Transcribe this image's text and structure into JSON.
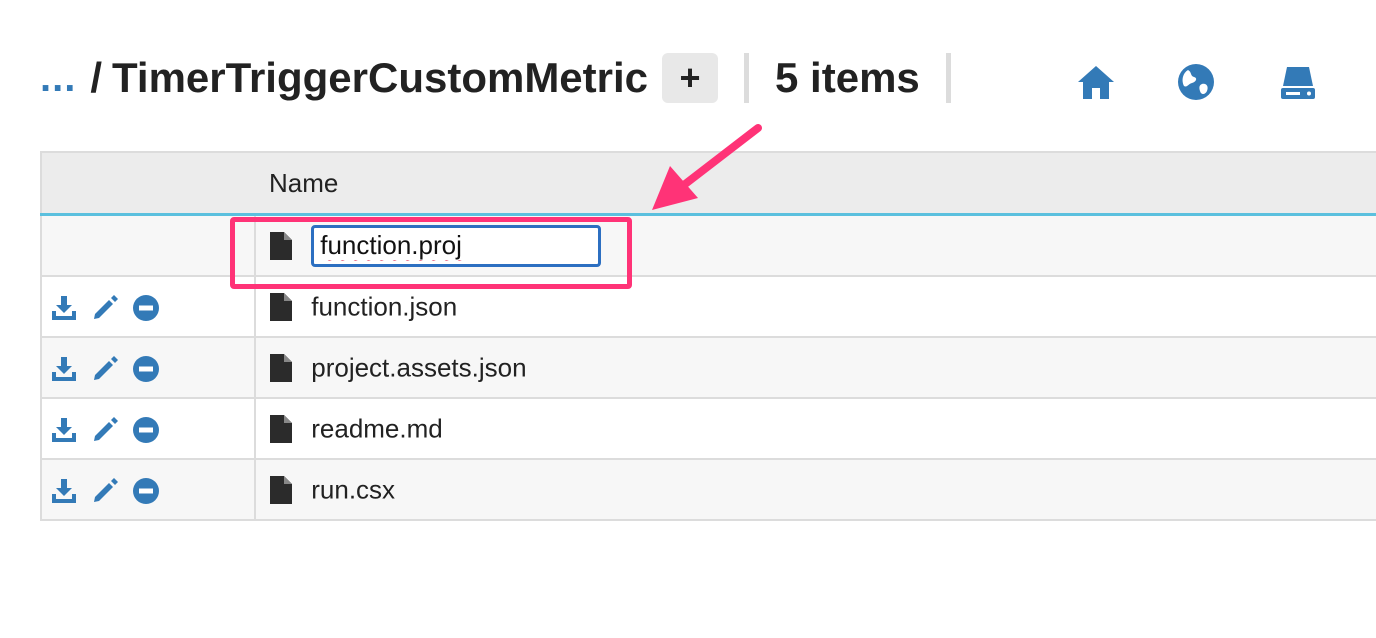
{
  "breadcrumb": {
    "ellipsis": "...",
    "separator": "/",
    "current_folder": "TimerTriggerCustomMetric",
    "add_label": "+"
  },
  "item_count": "5 items",
  "nav_icons": [
    "home-icon",
    "globe-icon",
    "drive-icon"
  ],
  "table": {
    "columns": [
      "",
      "Name"
    ],
    "rename_row": {
      "icon": "file-icon",
      "input_value": "function.proj"
    },
    "rows": [
      {
        "name": "function.json",
        "actions": [
          "download-icon",
          "pencil-icon",
          "minus-circle-icon"
        ]
      },
      {
        "name": "project.assets.json",
        "actions": [
          "download-icon",
          "pencil-icon",
          "minus-circle-icon"
        ]
      },
      {
        "name": "readme.md",
        "actions": [
          "download-icon",
          "pencil-icon",
          "minus-circle-icon"
        ]
      },
      {
        "name": "run.csx",
        "actions": [
          "download-icon",
          "pencil-icon",
          "minus-circle-icon"
        ]
      }
    ]
  },
  "colors": {
    "accent_blue": "#337ab7",
    "header_underline": "#5bc0de",
    "annotation_pink": "#ff3377",
    "input_border": "#2c6fc1"
  }
}
